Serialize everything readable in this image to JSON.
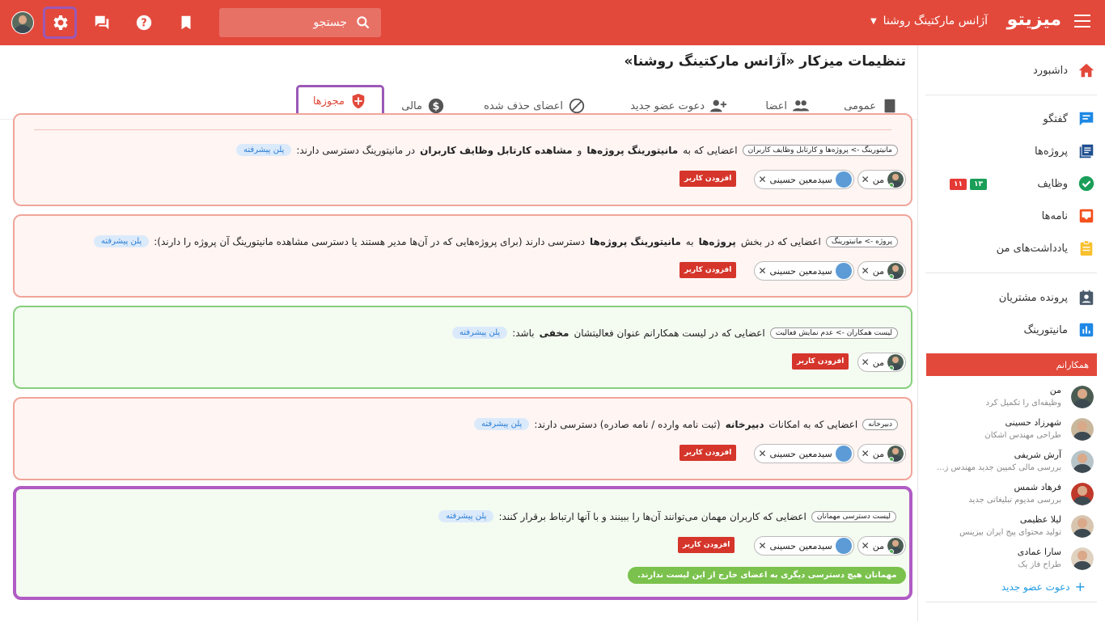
{
  "topbar": {
    "brand": "میزیتو",
    "org_name": "آژانس مارکتینگ روشنا",
    "search_placeholder": "جستجو"
  },
  "page": {
    "title": "تنظیمات میزکار «آژانس مارکتینگ روشنا»"
  },
  "tabs": [
    {
      "label": "عمومی"
    },
    {
      "label": "اعضا"
    },
    {
      "label": "دعوت عضو جدید"
    },
    {
      "label": "اعضای حذف شده"
    },
    {
      "label": "مالی"
    },
    {
      "label": "مجوزها"
    }
  ],
  "sidebar": {
    "items": [
      {
        "label": "داشبورد"
      },
      {
        "label": "گفتگو"
      },
      {
        "label": "پروژه‌ها"
      },
      {
        "label": "وظایف"
      },
      {
        "label": "نامه‌ها"
      },
      {
        "label": "یادداشت‌های من"
      },
      {
        "label": "پرونده مشتریان"
      },
      {
        "label": "مانیتورینگ"
      }
    ],
    "task_badges": {
      "done": "۱۳",
      "overdue": "۱۱"
    },
    "colleagues_title": "همکارانم",
    "colleagues": [
      {
        "name": "من",
        "sub": "وظیفه‌ای را تکمیل کرد"
      },
      {
        "name": "شهرزاد حسینی",
        "sub": "طراحی مهندس اشکان"
      },
      {
        "name": "آرش شریفی",
        "sub": "بررسی مالی کمپین جدید مهندس ز..."
      },
      {
        "name": "فرهاد شمس",
        "sub": "بررسی مدیوم تبلیغاتی جدید"
      },
      {
        "name": "لیلا عظیمی",
        "sub": "تولید محتوای پیج ایران بیزینس"
      },
      {
        "name": "سارا عمادی",
        "sub": "طراح فاز یک"
      }
    ],
    "invite_label": "دعوت عضو جدید"
  },
  "common": {
    "plan_label": "پلن پیشرفته",
    "add_user": "افزودن کاربر",
    "me": "من",
    "member_name": "سیدمعین حسینی"
  },
  "cards": [
    {
      "tag": "مانیتورینگ -> پروژه‌ها و کارتابل وظایف کاربران",
      "t1": "اعضایی که به",
      "b1": "مانیتورینگ پروژه‌ها",
      "t2": "و",
      "b2": "مشاهده کارتابل وظایف کاربران",
      "t3": "در مانیتورینگ دسترسی دارند:"
    },
    {
      "tag": "پروژه -> مانیتورینگ",
      "t1": "اعضایی که در بخش",
      "b1": "پروژه‌ها",
      "t2": "به",
      "b2": "مانیتورینگ پروژه‌ها",
      "t3": "دسترسی دارند (برای پروژه‌هایی که در آن‌ها مدیر هستند یا دسترسی مشاهده مانیتورینگ آن پروژه را دارند):"
    },
    {
      "tag": "لیست همکاران -> عدم نمایش فعالیت",
      "t1": "اعضایی که در لیست همکارانم عنوان فعالیتشان",
      "b1": "مخفی",
      "t2": "باشد:"
    },
    {
      "tag": "دبیرخانه",
      "t1": "اعضایی که به امکانات",
      "b1": "دبیرخانه",
      "t2": "(ثبت نامه وارده / نامه صادره) دسترسی دارند:"
    },
    {
      "tag": "لیست دسترسی مهمانان",
      "t1": "اعضایی که کاربران مهمان می‌توانند آن‌ها را ببینند و با آنها ارتباط برقرار کنند:",
      "note": "مهمانان هیچ دسترسی دیگری به اعضای خارج از این لیست ندارند."
    }
  ],
  "colors": {
    "brand": "#e2493b",
    "highlight": "#9b59b6",
    "card_red_border": "#f0a59a",
    "card_green_border": "#86d07c"
  }
}
